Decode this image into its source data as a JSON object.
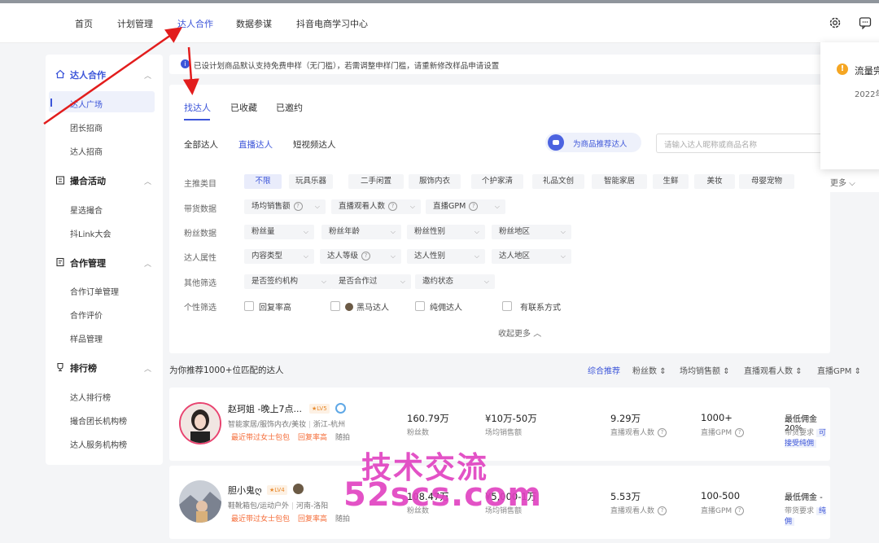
{
  "nav": {
    "items": [
      "首页",
      "计划管理",
      "达人合作",
      "数据参谋",
      "抖音电商学习中心"
    ],
    "active_index": 2
  },
  "sidebar": {
    "sections": [
      {
        "title": "达人合作",
        "icon": "home-icon",
        "items": [
          "达人广场",
          "团长招商",
          "达人招商"
        ]
      },
      {
        "title": "撮合活动",
        "icon": "calendar-icon",
        "items": [
          "星选撮合",
          "抖Link大会"
        ]
      },
      {
        "title": "合作管理",
        "icon": "document-icon",
        "items": [
          "合作订单管理",
          "合作评价",
          "样品管理"
        ]
      },
      {
        "title": "排行榜",
        "icon": "trophy-icon",
        "items": [
          "达人排行榜",
          "撮合团长机构榜",
          "达人服务机构榜"
        ]
      }
    ],
    "active_item": "达人广场"
  },
  "notice": {
    "text": "已设计划商品默认支持免费申样（无门槛），若需调整申样门槛，请重新修改样品申请设置"
  },
  "tabs": [
    "找达人",
    "已收藏",
    "已邀约"
  ],
  "subtabs": [
    "全部达人",
    "直播达人",
    "短视频达人"
  ],
  "recommend_button": "为商品推荐达人",
  "search": {
    "placeholder": "请输入达人昵称或商品名称"
  },
  "filters": {
    "main_category": {
      "label": "主推类目",
      "chips": [
        "不限",
        "玩具乐器",
        "二手闲置",
        "服饰内衣",
        "个护家清",
        "礼品文创",
        "智能家居",
        "生鲜",
        "美妆",
        "母婴宠物"
      ],
      "more": "更多"
    },
    "sales_data": {
      "label": "带货数据",
      "dropdowns": [
        "场均销售额",
        "直播观看人数",
        "直播GPM"
      ]
    },
    "fan_data": {
      "label": "粉丝数据",
      "dropdowns": [
        "粉丝量",
        "粉丝年龄",
        "粉丝性别",
        "粉丝地区"
      ]
    },
    "attributes": {
      "label": "达人属性",
      "dropdowns": [
        "内容类型",
        "达人等级",
        "达人性别",
        "达人地区"
      ]
    },
    "other": {
      "label": "其他筛选",
      "dropdowns": [
        "是否签约机构",
        "是否合作过",
        "邀约状态"
      ]
    },
    "personal": {
      "label": "个性筛选",
      "checkboxes": [
        "回复率高",
        "黑马达人",
        "纯佣达人",
        "有联系方式"
      ]
    },
    "collapse": "收起更多"
  },
  "list": {
    "heading": "为你推荐1000+位匹配的达人",
    "sort": [
      "综合推荐",
      "粉丝数",
      "场均销售额",
      "直播观看人数",
      "直播GPM"
    ]
  },
  "influencers": [
    {
      "name": "赵珂姐 -晚上7点...",
      "level": "LV5",
      "category": "智能家居/服饰内衣/美妆",
      "location": "浙江-杭州",
      "tags": [
        "最近带过女士包包",
        "回复率高",
        "随拍"
      ],
      "fans": "160.79万",
      "fans_label": "粉丝数",
      "sales": "¥10万-50万",
      "sales_label": "场均销售额",
      "viewers": "9.29万",
      "viewers_label": "直播观看人数",
      "gpm": "1000+",
      "gpm_label": "直播GPM",
      "commission": "最低佣金 20%",
      "req_label": "带货要求",
      "req": "可接受纯佣"
    },
    {
      "name": "胆小鬼ღ",
      "level": "LV4",
      "category": "鞋靴箱包/运动户外",
      "location": "河南-洛阳",
      "tags": [
        "最近带过女士包包",
        "回复率高",
        "随拍"
      ],
      "fans": "108.47万",
      "fans_label": "粉丝数",
      "sales": "¥5,000-1万",
      "sales_label": "场均销售额",
      "viewers": "5.53万",
      "viewers_label": "直播观看人数",
      "gpm": "100-500",
      "gpm_label": "直播GPM",
      "commission": "最低佣金 -",
      "req_label": "带货要求",
      "req": "纯佣"
    }
  ],
  "popup": {
    "title": "流量完",
    "date": "2022年"
  },
  "watermark": {
    "line1": "技术交流",
    "line2": "52scs.com"
  },
  "colors": {
    "accent": "#3c55d9",
    "tag": "#f56c38",
    "watermark": "#e040c0",
    "warning": "#f5a623"
  }
}
